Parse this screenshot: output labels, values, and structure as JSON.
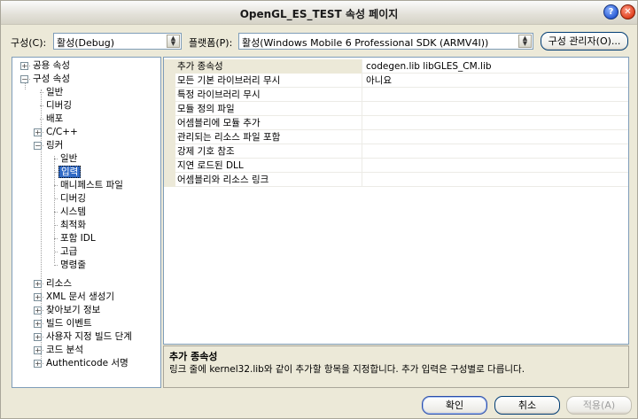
{
  "window": {
    "title": "OpenGL_ES_TEST 속성 페이지",
    "help_glyph": "?",
    "close_glyph": "✕"
  },
  "toolbar": {
    "config_label": "구성(C):",
    "config_value": "활성(Debug)",
    "platform_label": "플랫폼(P):",
    "platform_value": "활성(Windows Mobile 6 Professional SDK (ARMV4I))",
    "config_manager_button": "구성 관리자(O)..."
  },
  "tree": {
    "nodes": [
      {
        "label": "공용 속성",
        "expander": "+"
      },
      {
        "label": "구성 속성",
        "expander": "−"
      },
      {
        "label": "일반"
      },
      {
        "label": "디버깅"
      },
      {
        "label": "배포"
      },
      {
        "label": "C/C++",
        "expander": "+"
      },
      {
        "label": "링커",
        "expander": "−"
      },
      {
        "label": "일반"
      },
      {
        "label": "입력"
      },
      {
        "label": "매니페스트 파일"
      },
      {
        "label": "디버깅"
      },
      {
        "label": "시스템"
      },
      {
        "label": "최적화"
      },
      {
        "label": "포함 IDL"
      },
      {
        "label": "고급"
      },
      {
        "label": "명령줄"
      },
      {
        "label": "리소스",
        "expander": "+"
      },
      {
        "label": "XML 문서 생성기",
        "expander": "+"
      },
      {
        "label": "찾아보기 정보",
        "expander": "+"
      },
      {
        "label": "빌드 이벤트",
        "expander": "+"
      },
      {
        "label": "사용자 지정 빌드 단계",
        "expander": "+"
      },
      {
        "label": "코드 분석",
        "expander": "+"
      },
      {
        "label": "Authenticode 서명",
        "expander": "+"
      }
    ]
  },
  "grid": {
    "rows": [
      {
        "name": "추가 종속성",
        "value": "codegen.lib libGLES_CM.lib"
      },
      {
        "name": "모든 기본 라이브러리 무시",
        "value": "아니요"
      },
      {
        "name": "특정 라이브러리 무시",
        "value": ""
      },
      {
        "name": "모듈 정의 파일",
        "value": ""
      },
      {
        "name": "어셈블리에 모듈 추가",
        "value": ""
      },
      {
        "name": "관리되는 리소스 파일 포함",
        "value": ""
      },
      {
        "name": "강제 기호 참조",
        "value": ""
      },
      {
        "name": "지연 로드된 DLL",
        "value": ""
      },
      {
        "name": "어셈블리와 리소스 링크",
        "value": ""
      }
    ]
  },
  "description": {
    "title": "추가 종속성",
    "text": "링크 줄에 kernel32.lib와 같이 추가할 항목을 지정합니다. 추가 입력은 구성별로 다릅니다."
  },
  "buttons": {
    "ok": "확인",
    "cancel": "취소",
    "apply": "적용(A)"
  },
  "colors": {
    "selection": "#316ac5",
    "window_bg": "#ece9d8",
    "border": "#7f9db9"
  }
}
